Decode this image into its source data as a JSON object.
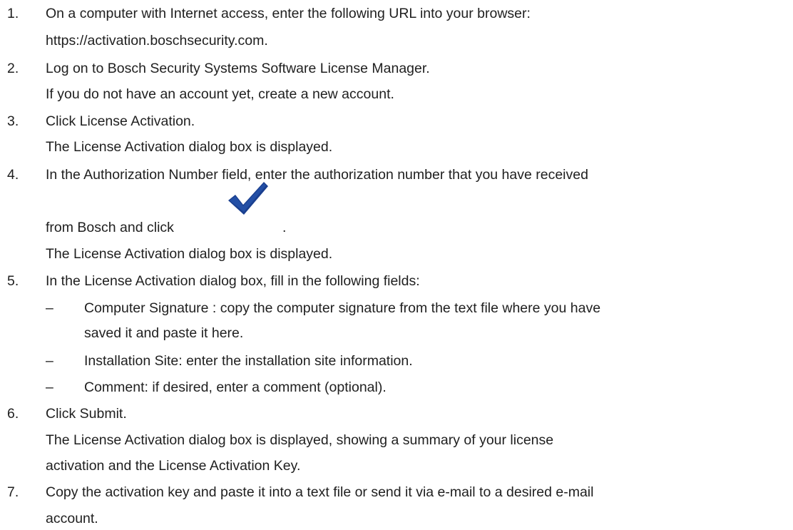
{
  "steps": [
    {
      "number": "1.",
      "lines": [
        "On a computer with Internet access, enter the following URL into your browser:",
        "https://activation.boschsecurity.com."
      ]
    },
    {
      "number": "2.",
      "lines": [
        "Log on to Bosch Security Systems Software License Manager.",
        "If you do not have an account yet, create a new account."
      ]
    },
    {
      "number": "3.",
      "lines": [
        "Click License Activation.",
        "The License Activation dialog box is displayed."
      ]
    },
    {
      "number": "4.",
      "lines": [
        "In the Authorization Number field, enter the authorization number that you have received",
        "from Bosch and click",
        ".",
        "The License Activation dialog box is displayed."
      ],
      "icon": "checkmark-icon"
    },
    {
      "number": "5.",
      "lines": [
        "In the License Activation dialog box, fill in the following fields:"
      ],
      "subitems": [
        {
          "bullet": "–",
          "lines": [
            "Computer Signature : copy the computer signature from the text file where you have",
            "saved it and paste it here."
          ]
        },
        {
          "bullet": "–",
          "lines": [
            "Installation Site: enter the installation site information."
          ]
        },
        {
          "bullet": "–",
          "lines": [
            "Comment: if desired, enter a comment (optional)."
          ]
        }
      ]
    },
    {
      "number": "6.",
      "lines": [
        "Click Submit.",
        "The License Activation dialog box is displayed, showing a summary of your license",
        "activation and the License Activation Key."
      ]
    },
    {
      "number": "7.",
      "lines": [
        "Copy the activation key and paste it into a text file or send it via e-mail to a desired e-mail",
        "account."
      ]
    }
  ],
  "colors": {
    "text": "#1f1f1f",
    "checkmark": "#1a3f8f"
  }
}
